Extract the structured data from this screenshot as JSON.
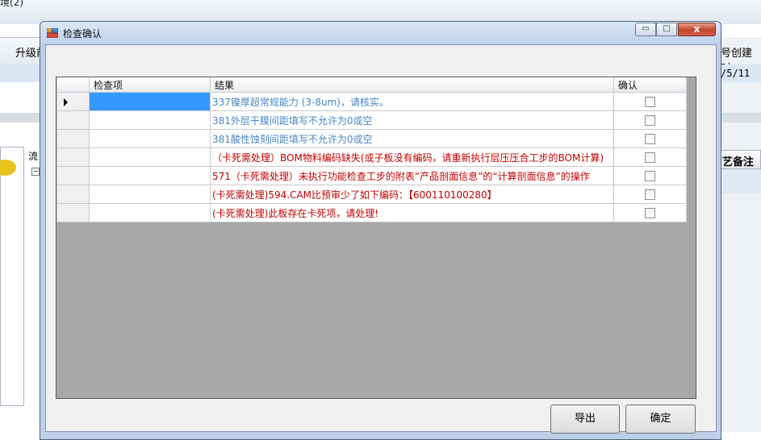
{
  "background": {
    "window_title": "境(2)",
    "toolbar_left_text": "升级前",
    "right_header_text": "号创建时",
    "selected_row_date": "/5/11",
    "panel_label": "流",
    "tree_toggle": "−",
    "column_header_right": "艺备注"
  },
  "dialog": {
    "title": "检查确认",
    "controls": {
      "minimize": "▭",
      "maximize": "□",
      "close": "x"
    },
    "grid": {
      "headers": {
        "item": "检查项",
        "result": "结果",
        "confirm": "确认"
      },
      "rows": [
        {
          "item": "",
          "result": "337镍厚超常规能力 (3-8um)，请核实。",
          "color": "#4a86c6"
        },
        {
          "item": "",
          "result": "381外层干膜间距填写不允许为0或空",
          "color": "#4a86c6"
        },
        {
          "item": "",
          "result": "381酸性蚀刻间距填写不允许为0或空",
          "color": "#4a86c6"
        },
        {
          "item": "",
          "result": "（卡死需处理）BOM物料编码缺失(或子板没有编码，请重新执行层压压合工步的BOM计算)",
          "color": "#c00000"
        },
        {
          "item": "",
          "result": "571（卡死需处理）未执行功能检查工步的附表“产品剖面信息”的“计算剖面信息”的操作",
          "color": "#c00000"
        },
        {
          "item": "",
          "result": "(卡死需处理)594.CAM比预审少了如下编码：【600110100280】",
          "color": "#c00000"
        },
        {
          "item": "",
          "result": "(卡死需处理)此板存在卡死项，请处理!",
          "color": "#c00000"
        }
      ]
    },
    "buttons": {
      "export": "导出",
      "ok": "确定"
    }
  },
  "colors": {
    "selection": "#3399ff",
    "info_text": "#4a86c6",
    "error_text": "#c00000",
    "grid_background": "#a8a8a8"
  }
}
